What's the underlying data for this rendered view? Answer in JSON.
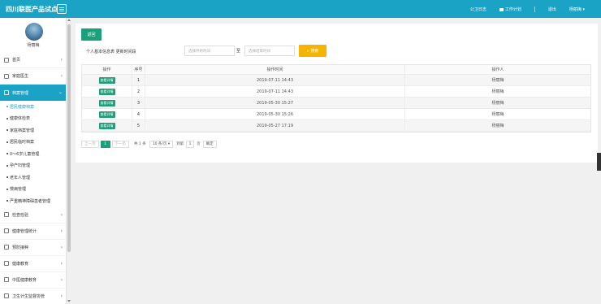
{
  "header": {
    "brand": "四川联医产品试点",
    "links": [
      "公卫日志",
      "工作计划",
      "退出",
      "杨丽梅 ▾"
    ]
  },
  "sidebar": {
    "user_name": "杨丽梅",
    "items_before": [
      {
        "label": "首页"
      },
      {
        "label": "家庭医生"
      }
    ],
    "active_item": {
      "label": "档案管理"
    },
    "sub_items": [
      {
        "label": "居民健康档案"
      },
      {
        "label": "健康体检表"
      },
      {
        "label": "家庭档案管理"
      },
      {
        "label": "居民临时档案"
      },
      {
        "label": "0～6岁儿童管理"
      },
      {
        "label": "孕产妇管理"
      },
      {
        "label": "老年人管理"
      },
      {
        "label": "慢病管理"
      },
      {
        "label": "严重精神障碍患者管理"
      }
    ],
    "items_after": [
      {
        "label": "检查检验"
      },
      {
        "label": "健康管理统计"
      },
      {
        "label": "预防接种"
      },
      {
        "label": "健康教育"
      },
      {
        "label": "中医健康教育"
      },
      {
        "label": "卫生计生监督协管"
      }
    ]
  },
  "toolbar": {
    "back_label": "返回",
    "filter_label": "个人基本信息表 更新时间段",
    "start_placeholder": "选择开始时间",
    "to_label": "至",
    "end_placeholder": "选择结束时间",
    "search_label": "搜索"
  },
  "table": {
    "headers": [
      "操作",
      "序号",
      "操作时间",
      "操作人"
    ],
    "row_button": "查看详情",
    "rows": [
      {
        "no": "1",
        "time": "2019-07-11 14:43",
        "user": "杨丽梅"
      },
      {
        "no": "2",
        "time": "2019-07-11 14:43",
        "user": "杨丽梅"
      },
      {
        "no": "3",
        "time": "2019-05-30 15:27",
        "user": "杨丽梅"
      },
      {
        "no": "4",
        "time": "2019-05-30 15:26",
        "user": "杨丽梅"
      },
      {
        "no": "5",
        "time": "2019-05-27 17:19",
        "user": "杨丽梅"
      }
    ]
  },
  "pager": {
    "prev": "上一页",
    "current": "1",
    "next": "下一页",
    "total": "共 1 条",
    "per_page": "10 条/页 ▾",
    "goto": "到第",
    "page_input": "1",
    "page_unit": "页",
    "confirm": "确定"
  }
}
